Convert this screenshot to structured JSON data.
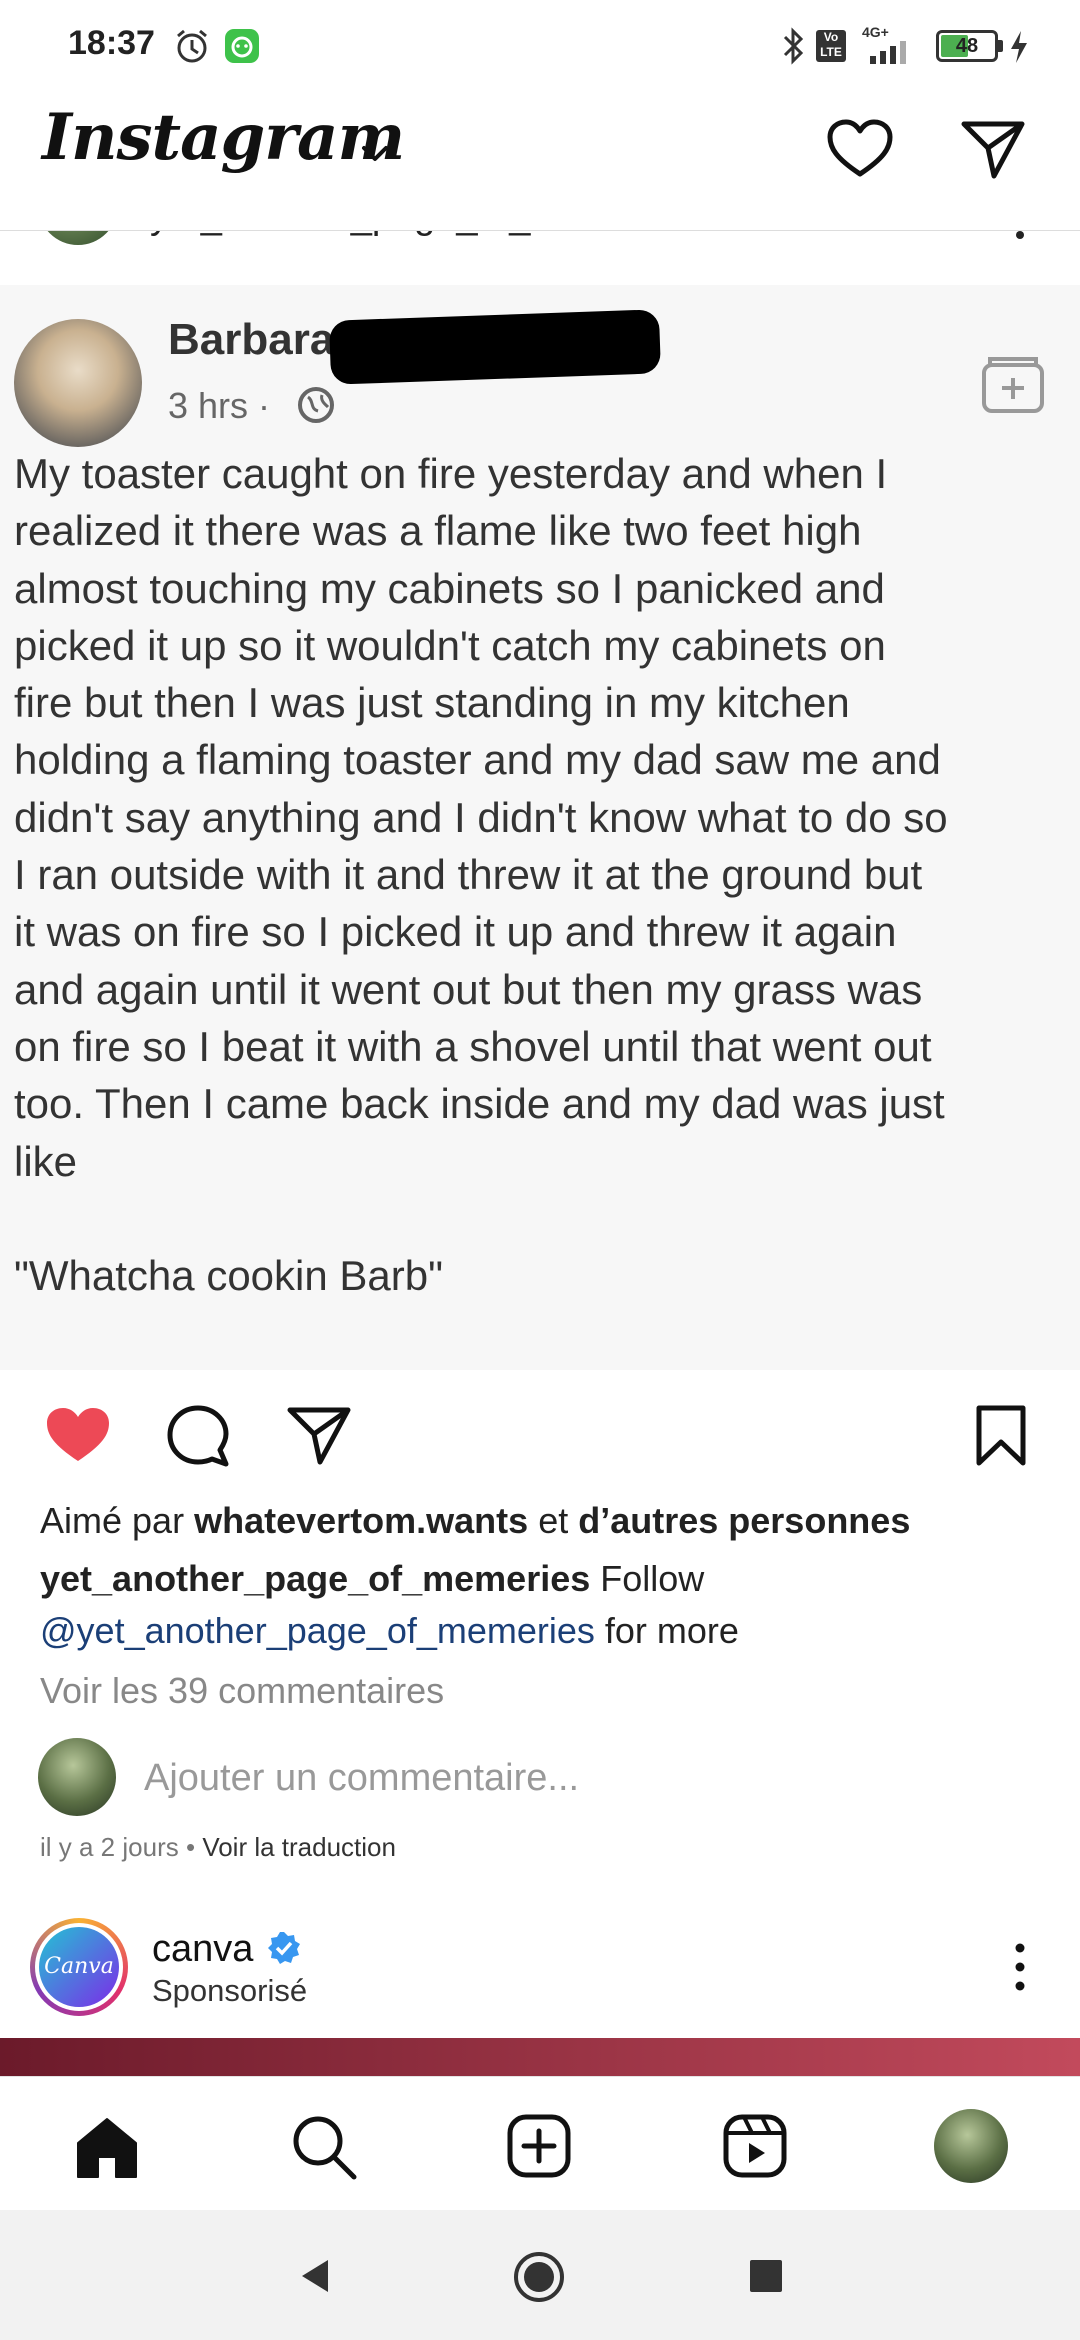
{
  "status_bar": {
    "time": "18:37",
    "battery": "48",
    "network": "4G+",
    "volte": "Vo LTE",
    "icons": [
      "alarm-icon",
      "app-notification-icon",
      "bluetooth-icon",
      "volte-icon",
      "signal-icon",
      "battery-icon",
      "charging-icon"
    ]
  },
  "header": {
    "logo": "Instagram",
    "icons": [
      "chevron-down-icon",
      "heart-icon",
      "direct-message-icon"
    ]
  },
  "previous_post": {
    "username": "yet_another_page_of_memeries"
  },
  "post": {
    "image": {
      "author_name": "Barbara",
      "time": "3 hrs ·",
      "body_lines": [
        "My toaster caught on fire yesterday and when I",
        "realized it there was a flame like two feet high",
        "almost touching my cabinets so I panicked and",
        "picked it up so it wouldn't catch my cabinets on",
        "fire but then I was just standing in my kitchen",
        "holding a flaming toaster and my dad saw me and",
        "didn't say anything and I didn't know what to do so",
        "I ran outside with it and threw it at the ground but",
        "it was on fire so I picked it up and threw it again",
        "and again until it went out but then my grass was",
        "on fire so I beat it with a shovel until that went out",
        "too. Then I came back inside and my dad was just",
        "like"
      ],
      "quote": "\"Whatcha cookin Barb\""
    },
    "liked": true,
    "likes": {
      "prefix": "Aimé par",
      "user": "whatevertom.wants",
      "conj": "et",
      "others": "d’autres personnes"
    },
    "caption": {
      "username": "yet_another_page_of_memeries",
      "text": "Follow",
      "mention": "@yet_another_page_of_memeries",
      "suffix": "for more"
    },
    "view_comments": "Voir les 39 commentaires",
    "comment_placeholder": "Ajouter un commentaire...",
    "timestamp": "il y a 2 jours",
    "separator": "•",
    "translate": "Voir la traduction"
  },
  "next_post": {
    "username": "canva",
    "avatar_text": "Canva",
    "verified": true,
    "subtitle": "Sponsorisé"
  },
  "bottom_nav": [
    "home-icon",
    "search-icon",
    "create-icon",
    "reels-icon",
    "profile-avatar"
  ],
  "system_nav": [
    "back-icon",
    "home-circle-icon",
    "recents-icon"
  ],
  "colors": {
    "like_red": "#ed4956",
    "verified_blue": "#3897f0",
    "mention_blue": "#1b3f77",
    "battery_green": "#4caf50"
  }
}
